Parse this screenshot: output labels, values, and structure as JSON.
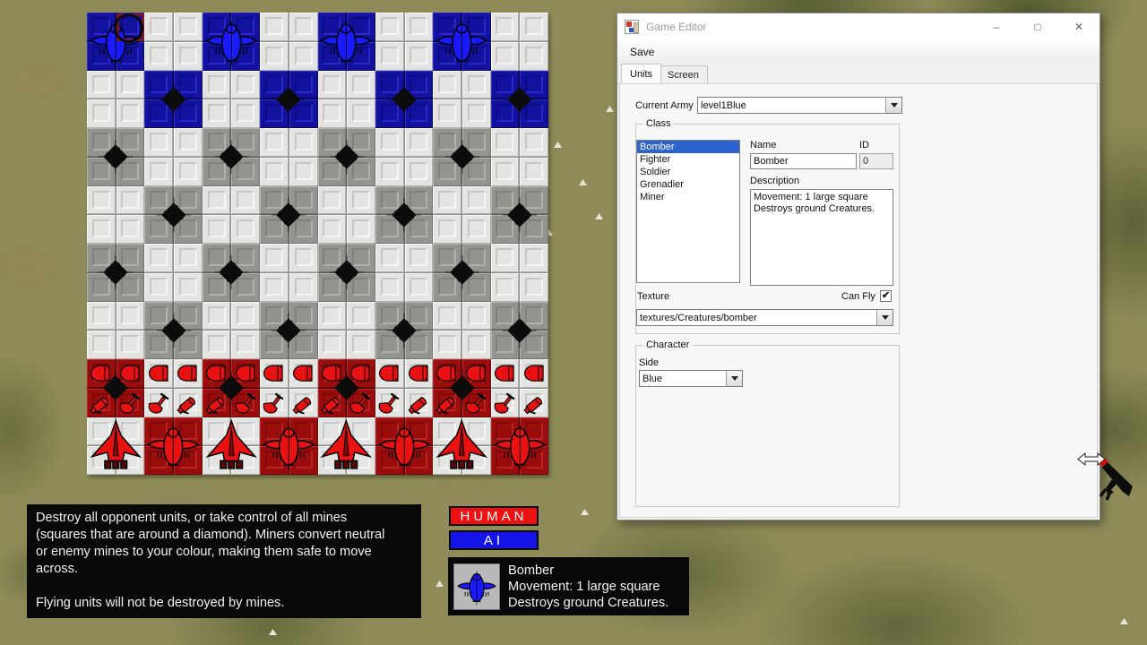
{
  "colors": {
    "blue_square": "#12129e",
    "blue_unit": "#1a1aff",
    "gray_square": "#94948f",
    "light_square": "#e4e4e2",
    "red_square": "#9a0d0d",
    "red_unit": "#e81212",
    "mine": "#0c0c0c",
    "human_badge": "#ee1111",
    "ai_badge": "#1414e6",
    "list_selection": "#2e62cf"
  },
  "board": {
    "rows": [
      [
        "blue-bomber",
        "empty",
        "blue-bomber",
        "empty",
        "blue-bomber",
        "empty",
        "blue-bomber",
        "empty"
      ],
      [
        "empty",
        "blue-mine",
        "empty",
        "blue-mine",
        "empty",
        "blue-mine",
        "empty",
        "blue-mine"
      ],
      [
        "gray-mine",
        "empty",
        "gray-mine",
        "empty",
        "gray-mine",
        "empty",
        "gray-mine",
        "empty"
      ],
      [
        "empty",
        "gray-mine",
        "empty",
        "gray-mine",
        "empty",
        "gray-mine",
        "empty",
        "gray-mine"
      ],
      [
        "gray-mine",
        "empty",
        "gray-mine",
        "empty",
        "gray-mine",
        "empty",
        "gray-mine",
        "empty"
      ],
      [
        "empty",
        "gray-mine",
        "empty",
        "gray-mine",
        "empty",
        "gray-mine",
        "empty",
        "gray-mine"
      ],
      [
        "red-mine-units",
        "red-units",
        "red-mine-units",
        "red-units",
        "red-mine-units",
        "red-units",
        "red-mine-units",
        "red-units"
      ],
      [
        "red-fighter",
        "red-bomber",
        "red-fighter",
        "red-bomber",
        "red-fighter",
        "red-bomber",
        "red-fighter",
        "red-bomber"
      ]
    ],
    "selection": {
      "row": 0,
      "col": 0,
      "subtile": "top-right"
    }
  },
  "editor_window": {
    "title": "Game Editor",
    "window_controls": {
      "minimize": "–",
      "maximize": "□",
      "close": "✕"
    },
    "menu": {
      "save_label": "Save"
    },
    "tabs": [
      {
        "label": "Units",
        "selected": true
      },
      {
        "label": "Screen",
        "selected": false
      }
    ],
    "current_army": {
      "label": "Current Army",
      "value": "level1Blue"
    },
    "class_group": {
      "label": "Class",
      "classes": [
        "Bomber",
        "Fighter",
        "Soldier",
        "Grenadier",
        "Miner"
      ],
      "selected_class": "Bomber",
      "name_label": "Name",
      "name_value": "Bomber",
      "id_label": "ID",
      "id_value": "0",
      "description_label": "Description",
      "description_value": "Movement: 1 large square\nDestroys ground Creatures.",
      "texture_label": "Texture",
      "texture_value": "textures/Creatures/bomber",
      "can_fly_label": "Can Fly",
      "can_fly_checked": true,
      "check_glyph": "✔"
    },
    "character_group": {
      "label": "Character",
      "side_label": "Side",
      "side_value": "Blue"
    }
  },
  "hud": {
    "instructions": "Destroy all opponent units, or take control of all mines\n(squares that are around a diamond). Miners convert neutral\nor enemy mines to your colour, making them safe to move\nacross.\n\nFlying units will not be destroyed by mines.",
    "players": [
      {
        "label": "HUMAN",
        "color": "#ee1111"
      },
      {
        "label": "AI",
        "color": "#1414e6"
      }
    ],
    "selected_unit": {
      "name": "Bomber",
      "line1": "Movement: 1 large square",
      "line2": "Destroys ground Creatures.",
      "icon": "bomber-blue-icon"
    }
  }
}
